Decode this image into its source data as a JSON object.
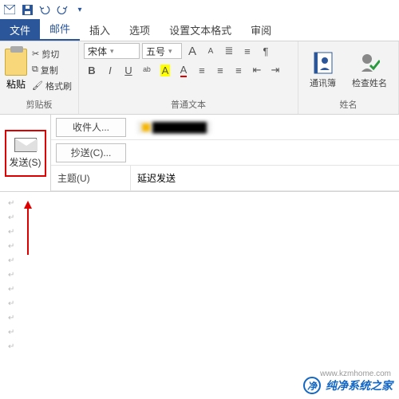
{
  "titlebar": {
    "qat": [
      "new-mail",
      "save",
      "undo",
      "redo",
      "down"
    ]
  },
  "tabs": {
    "file": "文件",
    "mail": "邮件",
    "insert": "插入",
    "options": "选项",
    "format": "设置文本格式",
    "review": "审阅"
  },
  "ribbon": {
    "clipboard": {
      "paste": "粘贴",
      "cut": "剪切",
      "copy": "复制",
      "painter": "格式刷",
      "group": "剪贴板"
    },
    "font": {
      "family": "宋体",
      "size": "五号",
      "group": "普通文本"
    },
    "names": {
      "addressbook": "通讯簿",
      "checknames": "检查姓名",
      "group": "姓名"
    }
  },
  "compose": {
    "send": "发送(S)",
    "to_label": "收件人...",
    "cc_label": "抄送(C)...",
    "subject_label": "主题(U)",
    "to_value": "",
    "cc_value": "",
    "subject_value": "延迟发送"
  },
  "watermark": {
    "text": "纯净系统之家",
    "url": "www.kzmhome.com"
  }
}
